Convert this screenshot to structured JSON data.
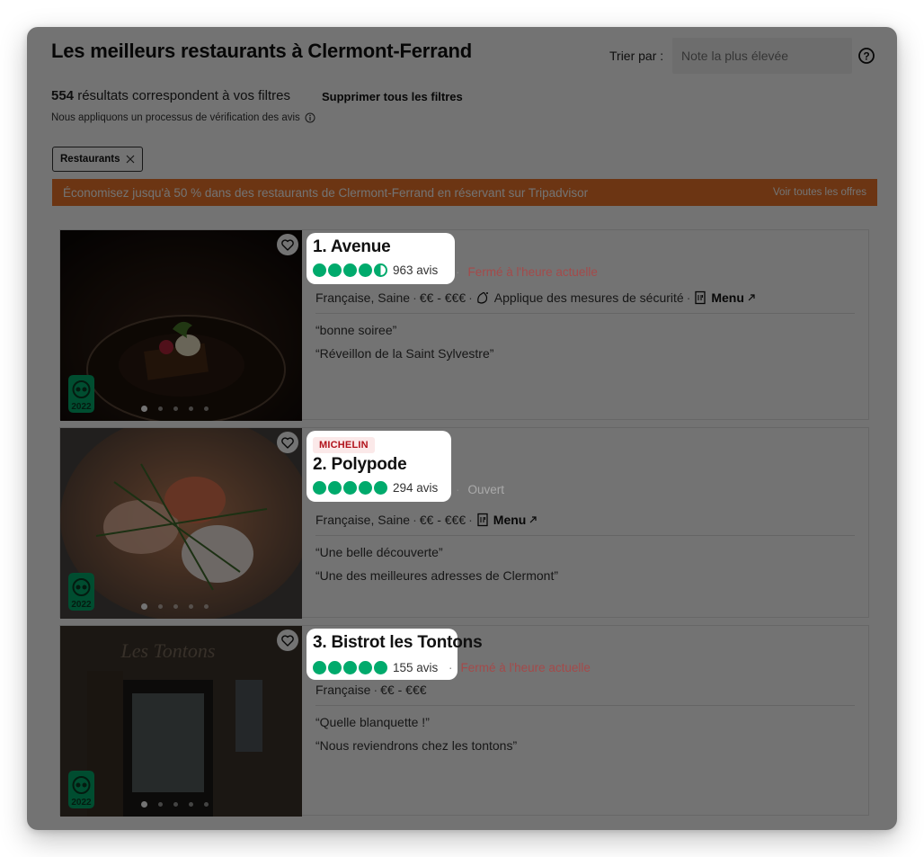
{
  "header": {
    "title": "Les meilleurs restaurants à Clermont-Ferrand",
    "sort_label": "Trier par :",
    "sort_placeholder": "Note la plus élevée"
  },
  "results": {
    "count": "554",
    "text": " résultats correspondent à vos filtres",
    "clear_filters": "Supprimer tous les filtres",
    "verification": "Nous appliquons un processus de vérification des avis"
  },
  "filters": [
    {
      "label": "Restaurants"
    }
  ],
  "promo": {
    "text": "Économisez jusqu'à 50 % dans des restaurants de Clermont-Ferrand en réservant sur Tripadvisor",
    "link": "Voir toutes les offres"
  },
  "restaurants": [
    {
      "name": "1. Avenue",
      "rating": 4.5,
      "reviews": "963 avis",
      "status": "Fermé à l'heure actuelle",
      "cuisine": "Française, Saine",
      "price": "€€ - €€€",
      "safety": "Applique des mesures de sécurité",
      "menu": "Menu",
      "quotes": [
        "“bonne soiree”",
        "“Réveillon de la Saint Sylvestre”"
      ],
      "award_year": "2022"
    },
    {
      "badge": "MICHELIN",
      "name": "2. Polypode",
      "rating": 5,
      "reviews": "294 avis",
      "status": "Ouvert",
      "cuisine": "Française, Saine",
      "price": "€€ - €€€",
      "menu": "Menu",
      "quotes": [
        "“Une belle découverte”",
        "“Une des meilleures adresses de Clermont”"
      ],
      "award_year": "2022"
    },
    {
      "name": "3. Bistrot les Tontons",
      "rating": 5,
      "reviews": "155 avis",
      "status": "Fermé à l'heure actuelle",
      "cuisine": "Française",
      "price": "€€ - €€€",
      "quotes": [
        "“Quelle blanquette !”",
        "“Nous reviendrons chez les tontons”"
      ],
      "award_year": "2022"
    }
  ],
  "colors": {
    "bubble": "#00aa6c",
    "closed": "#c0262d",
    "promo": "#f0772a",
    "michelin": "#b1121b"
  }
}
